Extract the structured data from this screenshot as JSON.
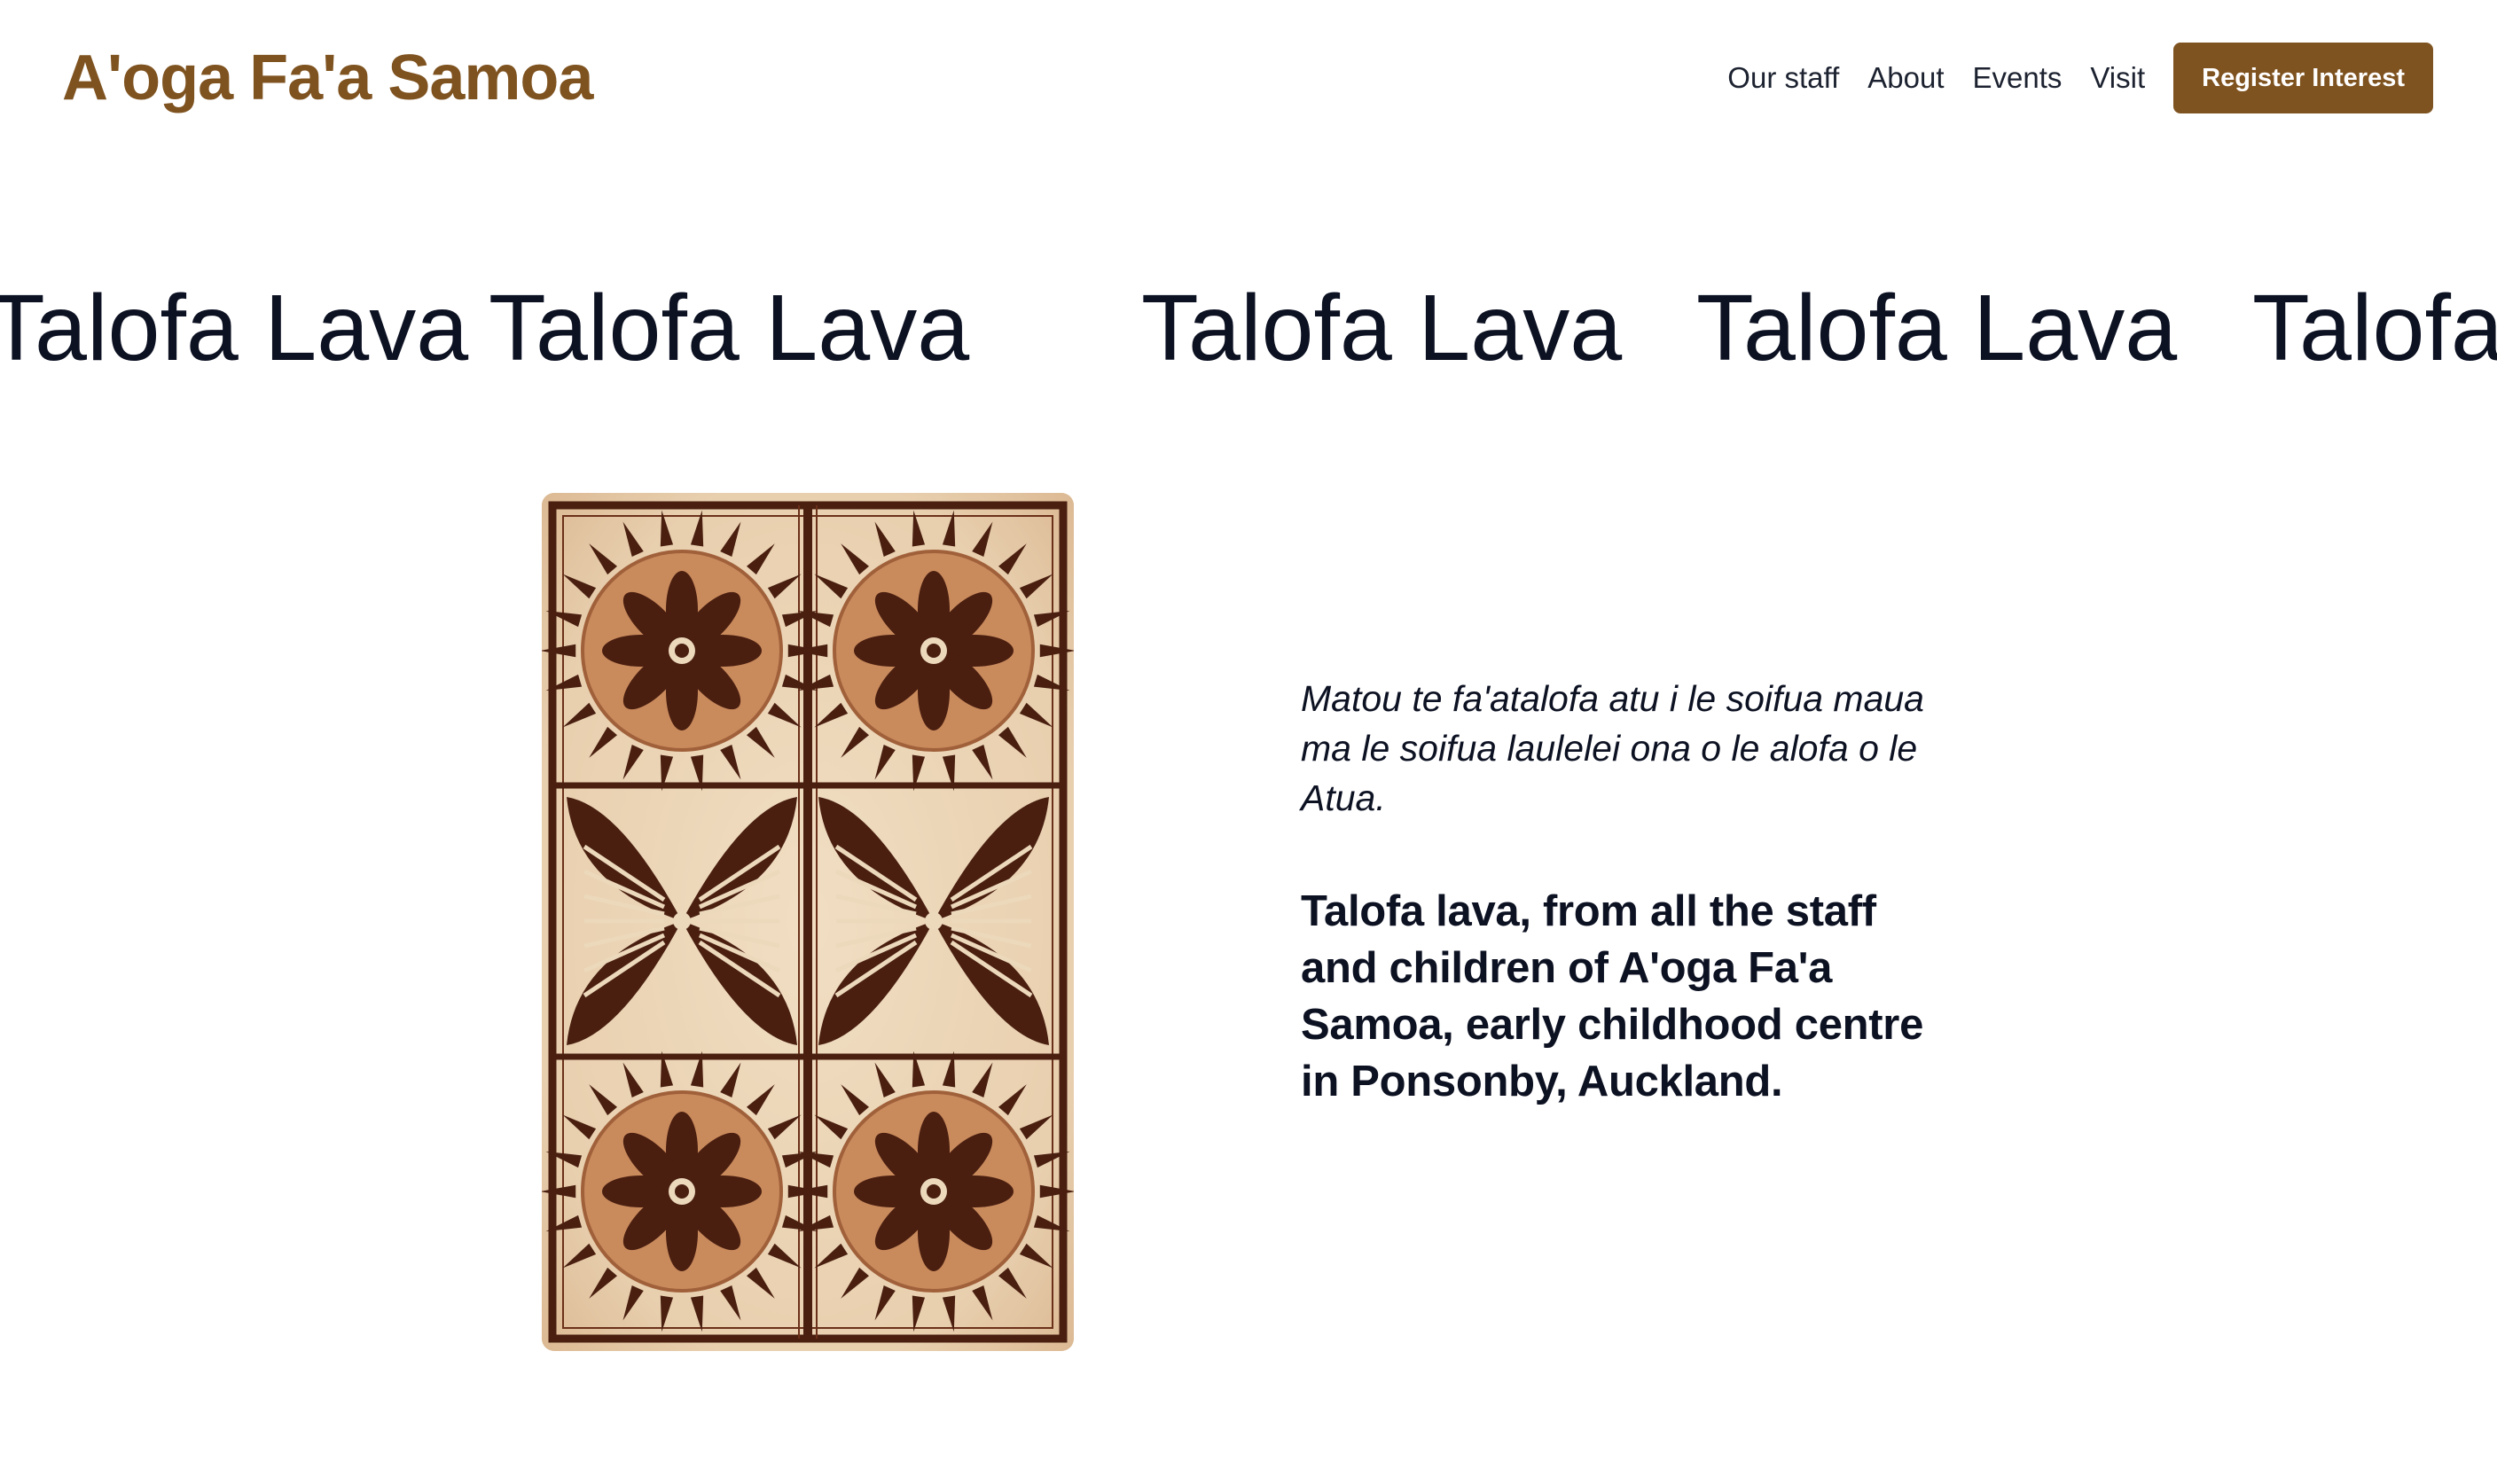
{
  "header": {
    "brand": "A'oga Fa'a Samoa",
    "nav": {
      "our_staff": "Our staff",
      "about": "About",
      "events": "Events",
      "visit": "Visit",
      "register": "Register Interest"
    }
  },
  "marquee": {
    "items": [
      "Talofa Lava",
      "Talofa Lava",
      "Talofa Lava",
      "Talofa Lava",
      "Talofa Lava"
    ]
  },
  "content": {
    "image_alt": "Samoan siapo tapa cloth pattern",
    "intro_italic": "Matou te fa'atalofa atu i le soifua maua ma le soifua laulelei ona o le alofa o le Atua.",
    "intro_bold": "Talofa lava, from all the staff and children of A'oga Fa'a Samoa, early childhood centre in Ponsonby, Auckland."
  },
  "colors": {
    "brand": "#7f5320",
    "text": "#0d1223",
    "tapa_dark": "#4a1f10",
    "tapa_mid": "#c98a5c",
    "tapa_light": "#ecd8bb"
  },
  "icons": {
    "tapa": "siapo-pattern-image"
  }
}
